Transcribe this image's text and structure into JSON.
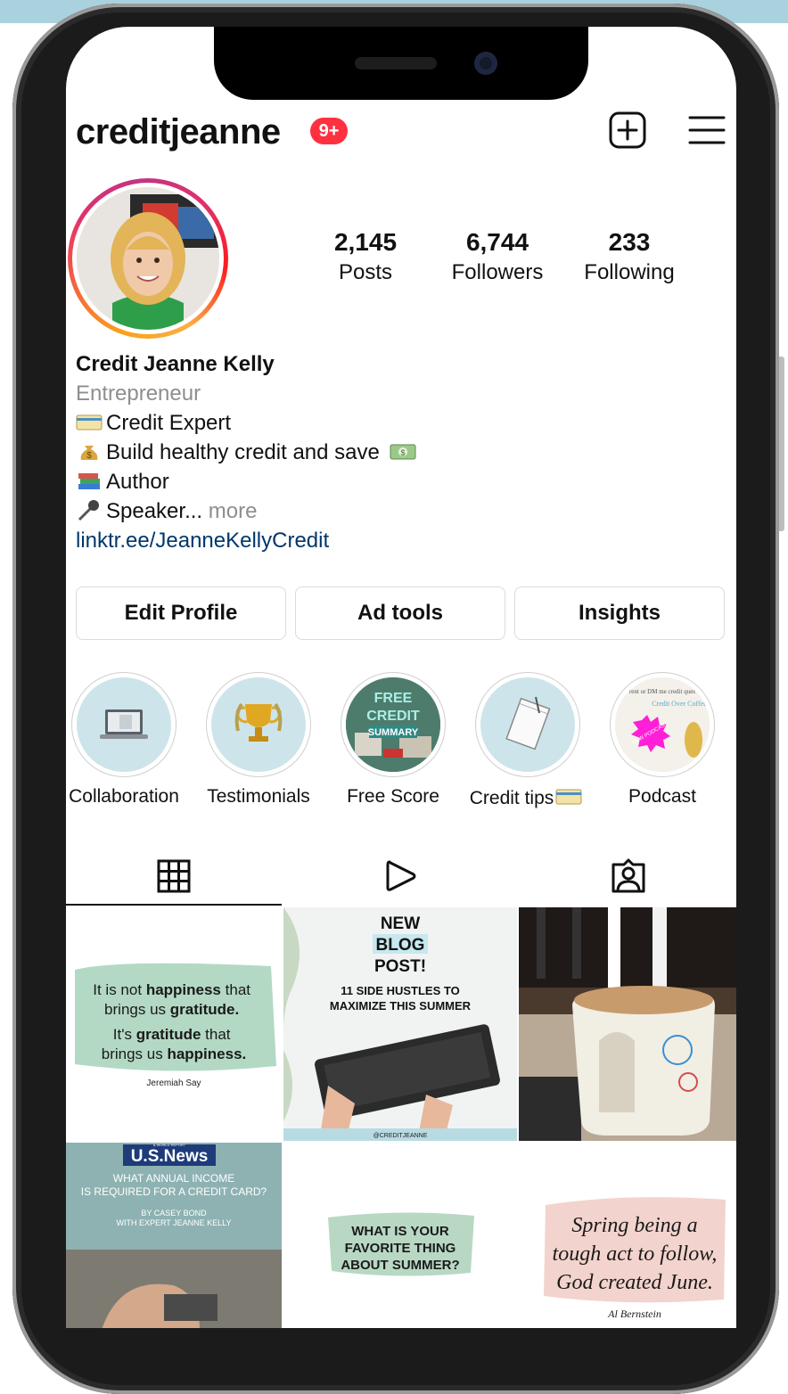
{
  "profile": {
    "username": "creditjeanne",
    "notification_badge": "9+",
    "stats": [
      {
        "value": "2,145",
        "label": "Posts"
      },
      {
        "value": "6,744",
        "label": "Followers"
      },
      {
        "value": "233",
        "label": "Following"
      }
    ],
    "display_name": "Credit Jeanne Kelly",
    "category": "Entrepreneur",
    "bio_lines": [
      "Credit Expert",
      "Build healthy credit and save",
      "Author",
      "Speaker..."
    ],
    "more_label": "more",
    "link": "linktr.ee/JeanneKellyCredit"
  },
  "actions": {
    "edit_profile": "Edit Profile",
    "ad_tools": "Ad tools",
    "insights": "Insights"
  },
  "highlights": [
    {
      "label": "Collaboration"
    },
    {
      "label": "Testimonials"
    },
    {
      "label": "Free Score"
    },
    {
      "label": "Credit tips"
    },
    {
      "label": "Podcast"
    }
  ],
  "highlight_text": {
    "free_score": [
      "FREE",
      "CREDIT",
      "SUMMARY"
    ],
    "podcast": [
      "rent or DM me credit ques",
      "Credit Over Coffee",
      "NEW PODCAST"
    ]
  },
  "tabs": [
    "grid-posts",
    "reels",
    "tagged"
  ],
  "posts": {
    "quote1_lines": [
      "It is not",
      "happiness",
      "that",
      "brings us",
      "gratitude.",
      "It's",
      "gratitude",
      "that",
      "brings us",
      "happiness."
    ],
    "quote1_author": "Jeremiah Say",
    "blog_lines": [
      "NEW",
      "BLOG",
      "POST!"
    ],
    "blog_sub": [
      "11 SIDE HUSTLES TO",
      "MAXIMIZE THIS SUMMER"
    ],
    "blog_handle": "@CREDITJEANNE",
    "usnews_logo": "U.S.News",
    "usnews_report": "& WORLD REPORT",
    "usnews_lines": [
      "WHAT ANNUAL INCOME",
      "IS REQUIRED FOR A CREDIT CARD?"
    ],
    "usnews_by": [
      "BY CASEY BOND",
      "WITH EXPERT JEANNE KELLY"
    ],
    "summer_lines": [
      "WHAT IS YOUR",
      "FAVORITE THING",
      "ABOUT SUMMER?"
    ],
    "spring_lines": [
      "Spring being a",
      "tough act to follow,",
      "God created June."
    ],
    "spring_author": "Al Bernstein"
  },
  "colors": {
    "badge": "#ff3040",
    "link": "#00376b",
    "highlight_bg": "#cde5ea",
    "frame_band": "#a9d2de"
  }
}
